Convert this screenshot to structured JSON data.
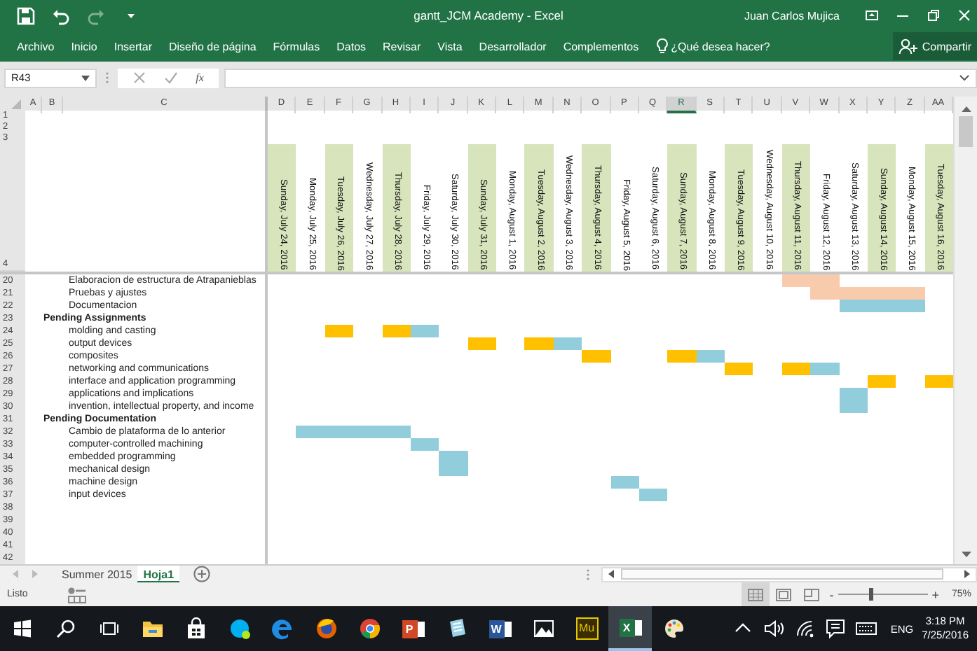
{
  "title_bar": {
    "quick_access": [
      {
        "kind": "save",
        "disabled": false
      },
      {
        "kind": "undo",
        "disabled": false
      },
      {
        "kind": "redo",
        "disabled": true
      },
      {
        "kind": "customize",
        "disabled": false
      }
    ],
    "title": "gantt_JCM Academy - Excel",
    "user": "Juan Carlos Mujica"
  },
  "ribbon": {
    "tabs": [
      "Archivo",
      "Inicio",
      "Insertar",
      "Diseño de página",
      "Fórmulas",
      "Datos",
      "Revisar",
      "Vista",
      "Desarrollador",
      "Complementos"
    ],
    "tell_me": "¿Qué desea hacer?",
    "share": "Compartir"
  },
  "formula_bar": {
    "name_box": "R43",
    "function_label": "fx"
  },
  "sheet": {
    "columns": [
      {
        "letter": "A",
        "selected": false
      },
      {
        "letter": "B",
        "selected": false
      },
      {
        "letter": "C",
        "selected": false
      },
      {
        "letter": "D",
        "selected": false,
        "date": "Sunday, July 24, 2016",
        "shaded": true
      },
      {
        "letter": "E",
        "selected": false,
        "date": "Monday, July 25, 2016",
        "shaded": false
      },
      {
        "letter": "F",
        "selected": false,
        "date": "Tuesday, July 26, 2016",
        "shaded": true
      },
      {
        "letter": "G",
        "selected": false,
        "date": "Wednesday, July 27, 2016",
        "shaded": false
      },
      {
        "letter": "H",
        "selected": false,
        "date": "Thursday, July 28, 2016",
        "shaded": true
      },
      {
        "letter": "I",
        "selected": false,
        "date": "Friday, July 29, 2016",
        "shaded": false
      },
      {
        "letter": "J",
        "selected": false,
        "date": "Saturday, July 30, 2016",
        "shaded": false
      },
      {
        "letter": "K",
        "selected": false,
        "date": "Sunday, July 31, 2016",
        "shaded": true
      },
      {
        "letter": "L",
        "selected": false,
        "date": "Monday, August 1, 2016",
        "shaded": false
      },
      {
        "letter": "M",
        "selected": false,
        "date": "Tuesday, August 2, 2016",
        "shaded": true
      },
      {
        "letter": "N",
        "selected": false,
        "date": "Wednesday, August 3, 2016",
        "shaded": false
      },
      {
        "letter": "O",
        "selected": false,
        "date": "Thursday, August 4, 2016",
        "shaded": true
      },
      {
        "letter": "P",
        "selected": false,
        "date": "Friday, August 5, 2016",
        "shaded": false
      },
      {
        "letter": "Q",
        "selected": false,
        "date": "Saturday, August 6, 2016",
        "shaded": false
      },
      {
        "letter": "R",
        "selected": true,
        "date": "Sunday, August 7, 2016",
        "shaded": true
      },
      {
        "letter": "S",
        "selected": false,
        "date": "Monday, August 8, 2016",
        "shaded": false
      },
      {
        "letter": "T",
        "selected": false,
        "date": "Tuesday, August 9, 2016",
        "shaded": true
      },
      {
        "letter": "U",
        "selected": false,
        "date": "Wednesday, August 10, 2016",
        "shaded": false
      },
      {
        "letter": "V",
        "selected": false,
        "date": "Thursday, August 11, 2016",
        "shaded": true
      },
      {
        "letter": "W",
        "selected": false,
        "date": "Friday, August 12, 2016",
        "shaded": false
      },
      {
        "letter": "X",
        "selected": false,
        "date": "Saturday, August 13, 2016",
        "shaded": false
      },
      {
        "letter": "Y",
        "selected": false,
        "date": "Sunday, August 14, 2016",
        "shaded": true
      },
      {
        "letter": "Z",
        "selected": false,
        "date": "Monday, August 15, 2016",
        "shaded": false
      },
      {
        "letter": "AA",
        "selected": false,
        "date": "Tuesday, August 16, 2016",
        "shaded": true
      }
    ],
    "top_rows": [
      "1",
      "2",
      "3"
    ],
    "date_row": "4",
    "rows": [
      {
        "number": "20",
        "kind": "task",
        "label": "Elaboracion de estructura de Atrapanieblas",
        "cells": [
          {
            "filled": false
          },
          {
            "filled": false
          },
          {
            "filled": false
          },
          {
            "filled": false
          },
          {
            "filled": false
          },
          {
            "filled": false
          },
          {
            "filled": false
          },
          {
            "filled": false
          },
          {
            "filled": false
          },
          {
            "filled": false
          },
          {
            "filled": false
          },
          {
            "filled": false
          },
          {
            "filled": false
          },
          {
            "filled": false
          },
          {
            "filled": false
          },
          {
            "filled": false
          },
          {
            "filled": false
          },
          {
            "filled": false
          },
          {
            "filled": true,
            "color": "#f8cbad"
          },
          {
            "filled": true,
            "color": "#f8cbad"
          },
          {
            "filled": false
          },
          {
            "filled": false
          },
          {
            "filled": false
          },
          {
            "filled": false
          }
        ]
      },
      {
        "number": "21",
        "kind": "task",
        "label": "Pruebas y ajustes",
        "cells": [
          {
            "filled": false
          },
          {
            "filled": false
          },
          {
            "filled": false
          },
          {
            "filled": false
          },
          {
            "filled": false
          },
          {
            "filled": false
          },
          {
            "filled": false
          },
          {
            "filled": false
          },
          {
            "filled": false
          },
          {
            "filled": false
          },
          {
            "filled": false
          },
          {
            "filled": false
          },
          {
            "filled": false
          },
          {
            "filled": false
          },
          {
            "filled": false
          },
          {
            "filled": false
          },
          {
            "filled": false
          },
          {
            "filled": false
          },
          {
            "filled": false
          },
          {
            "filled": true,
            "color": "#f8cbad"
          },
          {
            "filled": true,
            "color": "#f8cbad"
          },
          {
            "filled": true,
            "color": "#f8cbad"
          },
          {
            "filled": true,
            "color": "#f8cbad"
          },
          {
            "filled": false
          }
        ]
      },
      {
        "number": "22",
        "kind": "task",
        "label": "Documentacion",
        "cells": [
          {
            "filled": false
          },
          {
            "filled": false
          },
          {
            "filled": false
          },
          {
            "filled": false
          },
          {
            "filled": false
          },
          {
            "filled": false
          },
          {
            "filled": false
          },
          {
            "filled": false
          },
          {
            "filled": false
          },
          {
            "filled": false
          },
          {
            "filled": false
          },
          {
            "filled": false
          },
          {
            "filled": false
          },
          {
            "filled": false
          },
          {
            "filled": false
          },
          {
            "filled": false
          },
          {
            "filled": false
          },
          {
            "filled": false
          },
          {
            "filled": false
          },
          {
            "filled": false
          },
          {
            "filled": true,
            "color": "#92cddc"
          },
          {
            "filled": true,
            "color": "#92cddc"
          },
          {
            "filled": true,
            "color": "#92cddc"
          },
          {
            "filled": false
          }
        ]
      },
      {
        "number": "23",
        "kind": "heading",
        "label": "Pending Assignments"
      },
      {
        "number": "24",
        "kind": "task",
        "label": "molding and casting",
        "cells": [
          {
            "filled": false
          },
          {
            "filled": false
          },
          {
            "filled": true,
            "color": "#ffc000"
          },
          {
            "filled": false
          },
          {
            "filled": true,
            "color": "#ffc000"
          },
          {
            "filled": true,
            "color": "#92cddc"
          },
          {
            "filled": false
          },
          {
            "filled": false
          },
          {
            "filled": false
          },
          {
            "filled": false
          },
          {
            "filled": false
          },
          {
            "filled": false
          },
          {
            "filled": false
          },
          {
            "filled": false
          },
          {
            "filled": false
          },
          {
            "filled": false
          },
          {
            "filled": false
          },
          {
            "filled": false
          },
          {
            "filled": false
          },
          {
            "filled": false
          },
          {
            "filled": false
          },
          {
            "filled": false
          },
          {
            "filled": false
          },
          {
            "filled": false
          }
        ]
      },
      {
        "number": "25",
        "kind": "task",
        "label": "output devices",
        "cells": [
          {
            "filled": false
          },
          {
            "filled": false
          },
          {
            "filled": false
          },
          {
            "filled": false
          },
          {
            "filled": false
          },
          {
            "filled": false
          },
          {
            "filled": false
          },
          {
            "filled": true,
            "color": "#ffc000"
          },
          {
            "filled": false
          },
          {
            "filled": true,
            "color": "#ffc000"
          },
          {
            "filled": true,
            "color": "#92cddc"
          },
          {
            "filled": false
          },
          {
            "filled": false
          },
          {
            "filled": false
          },
          {
            "filled": false
          },
          {
            "filled": false
          },
          {
            "filled": false
          },
          {
            "filled": false
          },
          {
            "filled": false
          },
          {
            "filled": false
          },
          {
            "filled": false
          },
          {
            "filled": false
          },
          {
            "filled": false
          },
          {
            "filled": false
          }
        ]
      },
      {
        "number": "26",
        "kind": "task",
        "label": "composites",
        "cells": [
          {
            "filled": false
          },
          {
            "filled": false
          },
          {
            "filled": false
          },
          {
            "filled": false
          },
          {
            "filled": false
          },
          {
            "filled": false
          },
          {
            "filled": false
          },
          {
            "filled": false
          },
          {
            "filled": false
          },
          {
            "filled": false
          },
          {
            "filled": false
          },
          {
            "filled": true,
            "color": "#ffc000"
          },
          {
            "filled": false
          },
          {
            "filled": false
          },
          {
            "filled": true,
            "color": "#ffc000"
          },
          {
            "filled": true,
            "color": "#92cddc"
          },
          {
            "filled": false
          },
          {
            "filled": false
          },
          {
            "filled": false
          },
          {
            "filled": false
          },
          {
            "filled": false
          },
          {
            "filled": false
          },
          {
            "filled": false
          },
          {
            "filled": false
          }
        ]
      },
      {
        "number": "27",
        "kind": "task",
        "label": "networking and communications",
        "cells": [
          {
            "filled": false
          },
          {
            "filled": false
          },
          {
            "filled": false
          },
          {
            "filled": false
          },
          {
            "filled": false
          },
          {
            "filled": false
          },
          {
            "filled": false
          },
          {
            "filled": false
          },
          {
            "filled": false
          },
          {
            "filled": false
          },
          {
            "filled": false
          },
          {
            "filled": false
          },
          {
            "filled": false
          },
          {
            "filled": false
          },
          {
            "filled": false
          },
          {
            "filled": false
          },
          {
            "filled": true,
            "color": "#ffc000"
          },
          {
            "filled": false
          },
          {
            "filled": true,
            "color": "#ffc000"
          },
          {
            "filled": true,
            "color": "#92cddc"
          },
          {
            "filled": false
          },
          {
            "filled": false
          },
          {
            "filled": false
          },
          {
            "filled": false
          }
        ]
      },
      {
        "number": "28",
        "kind": "task",
        "label": "interface and application programming",
        "cells": [
          {
            "filled": false
          },
          {
            "filled": false
          },
          {
            "filled": false
          },
          {
            "filled": false
          },
          {
            "filled": false
          },
          {
            "filled": false
          },
          {
            "filled": false
          },
          {
            "filled": false
          },
          {
            "filled": false
          },
          {
            "filled": false
          },
          {
            "filled": false
          },
          {
            "filled": false
          },
          {
            "filled": false
          },
          {
            "filled": false
          },
          {
            "filled": false
          },
          {
            "filled": false
          },
          {
            "filled": false
          },
          {
            "filled": false
          },
          {
            "filled": false
          },
          {
            "filled": false
          },
          {
            "filled": false
          },
          {
            "filled": true,
            "color": "#ffc000"
          },
          {
            "filled": false
          },
          {
            "filled": true,
            "color": "#ffc000"
          }
        ]
      },
      {
        "number": "29",
        "kind": "task",
        "label": "applications and implications",
        "cells": [
          {
            "filled": false
          },
          {
            "filled": false
          },
          {
            "filled": false
          },
          {
            "filled": false
          },
          {
            "filled": false
          },
          {
            "filled": false
          },
          {
            "filled": false
          },
          {
            "filled": false
          },
          {
            "filled": false
          },
          {
            "filled": false
          },
          {
            "filled": false
          },
          {
            "filled": false
          },
          {
            "filled": false
          },
          {
            "filled": false
          },
          {
            "filled": false
          },
          {
            "filled": false
          },
          {
            "filled": false
          },
          {
            "filled": false
          },
          {
            "filled": false
          },
          {
            "filled": false
          },
          {
            "filled": true,
            "color": "#92cddc"
          },
          {
            "filled": false
          },
          {
            "filled": false
          },
          {
            "filled": false
          }
        ]
      },
      {
        "number": "30",
        "kind": "task",
        "label": "invention, intellectual property, and income",
        "cells": [
          {
            "filled": false
          },
          {
            "filled": false
          },
          {
            "filled": false
          },
          {
            "filled": false
          },
          {
            "filled": false
          },
          {
            "filled": false
          },
          {
            "filled": false
          },
          {
            "filled": false
          },
          {
            "filled": false
          },
          {
            "filled": false
          },
          {
            "filled": false
          },
          {
            "filled": false
          },
          {
            "filled": false
          },
          {
            "filled": false
          },
          {
            "filled": false
          },
          {
            "filled": false
          },
          {
            "filled": false
          },
          {
            "filled": false
          },
          {
            "filled": false
          },
          {
            "filled": false
          },
          {
            "filled": true,
            "color": "#92cddc"
          },
          {
            "filled": false
          },
          {
            "filled": false
          },
          {
            "filled": false
          }
        ]
      },
      {
        "number": "31",
        "kind": "heading",
        "label": "Pending Documentation"
      },
      {
        "number": "32",
        "kind": "task",
        "label": "Cambio de plataforma de lo anterior",
        "cells": [
          {
            "filled": false
          },
          {
            "filled": true,
            "color": "#92cddc"
          },
          {
            "filled": true,
            "color": "#92cddc"
          },
          {
            "filled": true,
            "color": "#92cddc"
          },
          {
            "filled": true,
            "color": "#92cddc"
          },
          {
            "filled": false
          },
          {
            "filled": false
          },
          {
            "filled": false
          },
          {
            "filled": false
          },
          {
            "filled": false
          },
          {
            "filled": false
          },
          {
            "filled": false
          },
          {
            "filled": false
          },
          {
            "filled": false
          },
          {
            "filled": false
          },
          {
            "filled": false
          },
          {
            "filled": false
          },
          {
            "filled": false
          },
          {
            "filled": false
          },
          {
            "filled": false
          },
          {
            "filled": false
          },
          {
            "filled": false
          },
          {
            "filled": false
          },
          {
            "filled": false
          }
        ]
      },
      {
        "number": "33",
        "kind": "task",
        "label": "computer-controlled machining",
        "cells": [
          {
            "filled": false
          },
          {
            "filled": false
          },
          {
            "filled": false
          },
          {
            "filled": false
          },
          {
            "filled": false
          },
          {
            "filled": true,
            "color": "#92cddc"
          },
          {
            "filled": false
          },
          {
            "filled": false
          },
          {
            "filled": false
          },
          {
            "filled": false
          },
          {
            "filled": false
          },
          {
            "filled": false
          },
          {
            "filled": false
          },
          {
            "filled": false
          },
          {
            "filled": false
          },
          {
            "filled": false
          },
          {
            "filled": false
          },
          {
            "filled": false
          },
          {
            "filled": false
          },
          {
            "filled": false
          },
          {
            "filled": false
          },
          {
            "filled": false
          },
          {
            "filled": false
          },
          {
            "filled": false
          }
        ]
      },
      {
        "number": "34",
        "kind": "task",
        "label": "embedded programming",
        "cells": [
          {
            "filled": false
          },
          {
            "filled": false
          },
          {
            "filled": false
          },
          {
            "filled": false
          },
          {
            "filled": false
          },
          {
            "filled": false
          },
          {
            "filled": true,
            "color": "#92cddc"
          },
          {
            "filled": false
          },
          {
            "filled": false
          },
          {
            "filled": false
          },
          {
            "filled": false
          },
          {
            "filled": false
          },
          {
            "filled": false
          },
          {
            "filled": false
          },
          {
            "filled": false
          },
          {
            "filled": false
          },
          {
            "filled": false
          },
          {
            "filled": false
          },
          {
            "filled": false
          },
          {
            "filled": false
          },
          {
            "filled": false
          },
          {
            "filled": false
          },
          {
            "filled": false
          },
          {
            "filled": false
          }
        ]
      },
      {
        "number": "35",
        "kind": "task",
        "label": "mechanical design",
        "cells": [
          {
            "filled": false
          },
          {
            "filled": false
          },
          {
            "filled": false
          },
          {
            "filled": false
          },
          {
            "filled": false
          },
          {
            "filled": false
          },
          {
            "filled": true,
            "color": "#92cddc"
          },
          {
            "filled": false
          },
          {
            "filled": false
          },
          {
            "filled": false
          },
          {
            "filled": false
          },
          {
            "filled": false
          },
          {
            "filled": false
          },
          {
            "filled": false
          },
          {
            "filled": false
          },
          {
            "filled": false
          },
          {
            "filled": false
          },
          {
            "filled": false
          },
          {
            "filled": false
          },
          {
            "filled": false
          },
          {
            "filled": false
          },
          {
            "filled": false
          },
          {
            "filled": false
          },
          {
            "filled": false
          }
        ]
      },
      {
        "number": "36",
        "kind": "task",
        "label": "machine design",
        "cells": [
          {
            "filled": false
          },
          {
            "filled": false
          },
          {
            "filled": false
          },
          {
            "filled": false
          },
          {
            "filled": false
          },
          {
            "filled": false
          },
          {
            "filled": false
          },
          {
            "filled": false
          },
          {
            "filled": false
          },
          {
            "filled": false
          },
          {
            "filled": false
          },
          {
            "filled": false
          },
          {
            "filled": true,
            "color": "#92cddc"
          },
          {
            "filled": false
          },
          {
            "filled": false
          },
          {
            "filled": false
          },
          {
            "filled": false
          },
          {
            "filled": false
          },
          {
            "filled": false
          },
          {
            "filled": false
          },
          {
            "filled": false
          },
          {
            "filled": false
          },
          {
            "filled": false
          },
          {
            "filled": false
          }
        ]
      },
      {
        "number": "37",
        "kind": "task",
        "label": "input devices",
        "cells": [
          {
            "filled": false
          },
          {
            "filled": false
          },
          {
            "filled": false
          },
          {
            "filled": false
          },
          {
            "filled": false
          },
          {
            "filled": false
          },
          {
            "filled": false
          },
          {
            "filled": false
          },
          {
            "filled": false
          },
          {
            "filled": false
          },
          {
            "filled": false
          },
          {
            "filled": false
          },
          {
            "filled": false
          },
          {
            "filled": true,
            "color": "#92cddc"
          },
          {
            "filled": false
          },
          {
            "filled": false
          },
          {
            "filled": false
          },
          {
            "filled": false
          },
          {
            "filled": false
          },
          {
            "filled": false
          },
          {
            "filled": false
          },
          {
            "filled": false
          },
          {
            "filled": false
          },
          {
            "filled": false
          }
        ]
      },
      {
        "number": "38",
        "kind": "blank"
      },
      {
        "number": "39",
        "kind": "blank"
      },
      {
        "number": "40",
        "kind": "blank"
      },
      {
        "number": "41",
        "kind": "blank"
      },
      {
        "number": "42",
        "kind": "blank"
      }
    ]
  },
  "sheet_tabs": [
    {
      "label": "Summer 2015",
      "selected": false
    },
    {
      "label": "Hoja1",
      "selected": true
    }
  ],
  "status_bar": {
    "status": "Listo",
    "views": [
      {
        "kind": "normal",
        "selected": true
      },
      {
        "kind": "layout",
        "selected": false
      },
      {
        "kind": "pagebreak",
        "selected": false
      }
    ],
    "zoom": {
      "minus": "-",
      "plus": "+",
      "level": 0.37,
      "reading": "75%"
    }
  },
  "taskbar": {
    "apps": [
      {
        "kind": "start",
        "selected": false
      },
      {
        "kind": "search",
        "selected": false
      },
      {
        "kind": "taskview",
        "selected": false
      },
      {
        "kind": "folder",
        "selected": false
      },
      {
        "kind": "store",
        "selected": false
      },
      {
        "kind": "skype",
        "selected": false
      },
      {
        "kind": "edge",
        "selected": false
      },
      {
        "kind": "firefox",
        "selected": false
      },
      {
        "kind": "chrome",
        "selected": false
      },
      {
        "kind": "office",
        "label": "P",
        "color": "#d24726",
        "selected": false
      },
      {
        "kind": "notes",
        "selected": false
      },
      {
        "kind": "office",
        "label": "W",
        "color": "#2b579a",
        "selected": false
      },
      {
        "kind": "photos",
        "selected": false
      },
      {
        "kind": "muse",
        "label": "Mu",
        "selected": false
      },
      {
        "kind": "office",
        "label": "X",
        "color": "#217346",
        "selected": true
      },
      {
        "kind": "paint",
        "selected": false
      }
    ],
    "tray": [
      {
        "kind": "caret"
      },
      {
        "kind": "volume"
      },
      {
        "kind": "wifi"
      },
      {
        "kind": "message"
      },
      {
        "kind": "keyboard"
      }
    ],
    "language": "ENG",
    "time": "3:18 PM",
    "date": "7/25/2016"
  }
}
